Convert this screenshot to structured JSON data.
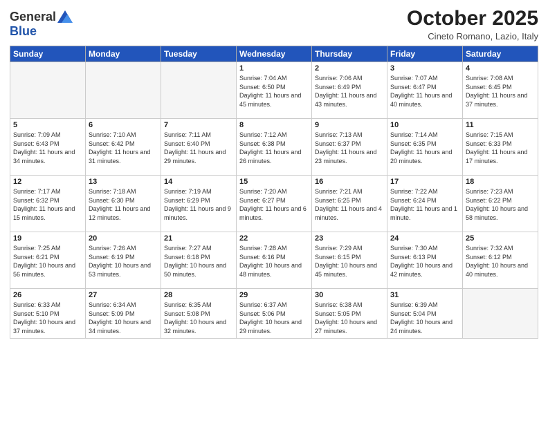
{
  "logo": {
    "general": "General",
    "blue": "Blue"
  },
  "header": {
    "month": "October 2025",
    "location": "Cineto Romano, Lazio, Italy"
  },
  "weekdays": [
    "Sunday",
    "Monday",
    "Tuesday",
    "Wednesday",
    "Thursday",
    "Friday",
    "Saturday"
  ],
  "weeks": [
    [
      {
        "day": "",
        "info": ""
      },
      {
        "day": "",
        "info": ""
      },
      {
        "day": "",
        "info": ""
      },
      {
        "day": "1",
        "info": "Sunrise: 7:04 AM\nSunset: 6:50 PM\nDaylight: 11 hours and 45 minutes."
      },
      {
        "day": "2",
        "info": "Sunrise: 7:06 AM\nSunset: 6:49 PM\nDaylight: 11 hours and 43 minutes."
      },
      {
        "day": "3",
        "info": "Sunrise: 7:07 AM\nSunset: 6:47 PM\nDaylight: 11 hours and 40 minutes."
      },
      {
        "day": "4",
        "info": "Sunrise: 7:08 AM\nSunset: 6:45 PM\nDaylight: 11 hours and 37 minutes."
      }
    ],
    [
      {
        "day": "5",
        "info": "Sunrise: 7:09 AM\nSunset: 6:43 PM\nDaylight: 11 hours and 34 minutes."
      },
      {
        "day": "6",
        "info": "Sunrise: 7:10 AM\nSunset: 6:42 PM\nDaylight: 11 hours and 31 minutes."
      },
      {
        "day": "7",
        "info": "Sunrise: 7:11 AM\nSunset: 6:40 PM\nDaylight: 11 hours and 29 minutes."
      },
      {
        "day": "8",
        "info": "Sunrise: 7:12 AM\nSunset: 6:38 PM\nDaylight: 11 hours and 26 minutes."
      },
      {
        "day": "9",
        "info": "Sunrise: 7:13 AM\nSunset: 6:37 PM\nDaylight: 11 hours and 23 minutes."
      },
      {
        "day": "10",
        "info": "Sunrise: 7:14 AM\nSunset: 6:35 PM\nDaylight: 11 hours and 20 minutes."
      },
      {
        "day": "11",
        "info": "Sunrise: 7:15 AM\nSunset: 6:33 PM\nDaylight: 11 hours and 17 minutes."
      }
    ],
    [
      {
        "day": "12",
        "info": "Sunrise: 7:17 AM\nSunset: 6:32 PM\nDaylight: 11 hours and 15 minutes."
      },
      {
        "day": "13",
        "info": "Sunrise: 7:18 AM\nSunset: 6:30 PM\nDaylight: 11 hours and 12 minutes."
      },
      {
        "day": "14",
        "info": "Sunrise: 7:19 AM\nSunset: 6:29 PM\nDaylight: 11 hours and 9 minutes."
      },
      {
        "day": "15",
        "info": "Sunrise: 7:20 AM\nSunset: 6:27 PM\nDaylight: 11 hours and 6 minutes."
      },
      {
        "day": "16",
        "info": "Sunrise: 7:21 AM\nSunset: 6:25 PM\nDaylight: 11 hours and 4 minutes."
      },
      {
        "day": "17",
        "info": "Sunrise: 7:22 AM\nSunset: 6:24 PM\nDaylight: 11 hours and 1 minute."
      },
      {
        "day": "18",
        "info": "Sunrise: 7:23 AM\nSunset: 6:22 PM\nDaylight: 10 hours and 58 minutes."
      }
    ],
    [
      {
        "day": "19",
        "info": "Sunrise: 7:25 AM\nSunset: 6:21 PM\nDaylight: 10 hours and 56 minutes."
      },
      {
        "day": "20",
        "info": "Sunrise: 7:26 AM\nSunset: 6:19 PM\nDaylight: 10 hours and 53 minutes."
      },
      {
        "day": "21",
        "info": "Sunrise: 7:27 AM\nSunset: 6:18 PM\nDaylight: 10 hours and 50 minutes."
      },
      {
        "day": "22",
        "info": "Sunrise: 7:28 AM\nSunset: 6:16 PM\nDaylight: 10 hours and 48 minutes."
      },
      {
        "day": "23",
        "info": "Sunrise: 7:29 AM\nSunset: 6:15 PM\nDaylight: 10 hours and 45 minutes."
      },
      {
        "day": "24",
        "info": "Sunrise: 7:30 AM\nSunset: 6:13 PM\nDaylight: 10 hours and 42 minutes."
      },
      {
        "day": "25",
        "info": "Sunrise: 7:32 AM\nSunset: 6:12 PM\nDaylight: 10 hours and 40 minutes."
      }
    ],
    [
      {
        "day": "26",
        "info": "Sunrise: 6:33 AM\nSunset: 5:10 PM\nDaylight: 10 hours and 37 minutes."
      },
      {
        "day": "27",
        "info": "Sunrise: 6:34 AM\nSunset: 5:09 PM\nDaylight: 10 hours and 34 minutes."
      },
      {
        "day": "28",
        "info": "Sunrise: 6:35 AM\nSunset: 5:08 PM\nDaylight: 10 hours and 32 minutes."
      },
      {
        "day": "29",
        "info": "Sunrise: 6:37 AM\nSunset: 5:06 PM\nDaylight: 10 hours and 29 minutes."
      },
      {
        "day": "30",
        "info": "Sunrise: 6:38 AM\nSunset: 5:05 PM\nDaylight: 10 hours and 27 minutes."
      },
      {
        "day": "31",
        "info": "Sunrise: 6:39 AM\nSunset: 5:04 PM\nDaylight: 10 hours and 24 minutes."
      },
      {
        "day": "",
        "info": ""
      }
    ]
  ]
}
